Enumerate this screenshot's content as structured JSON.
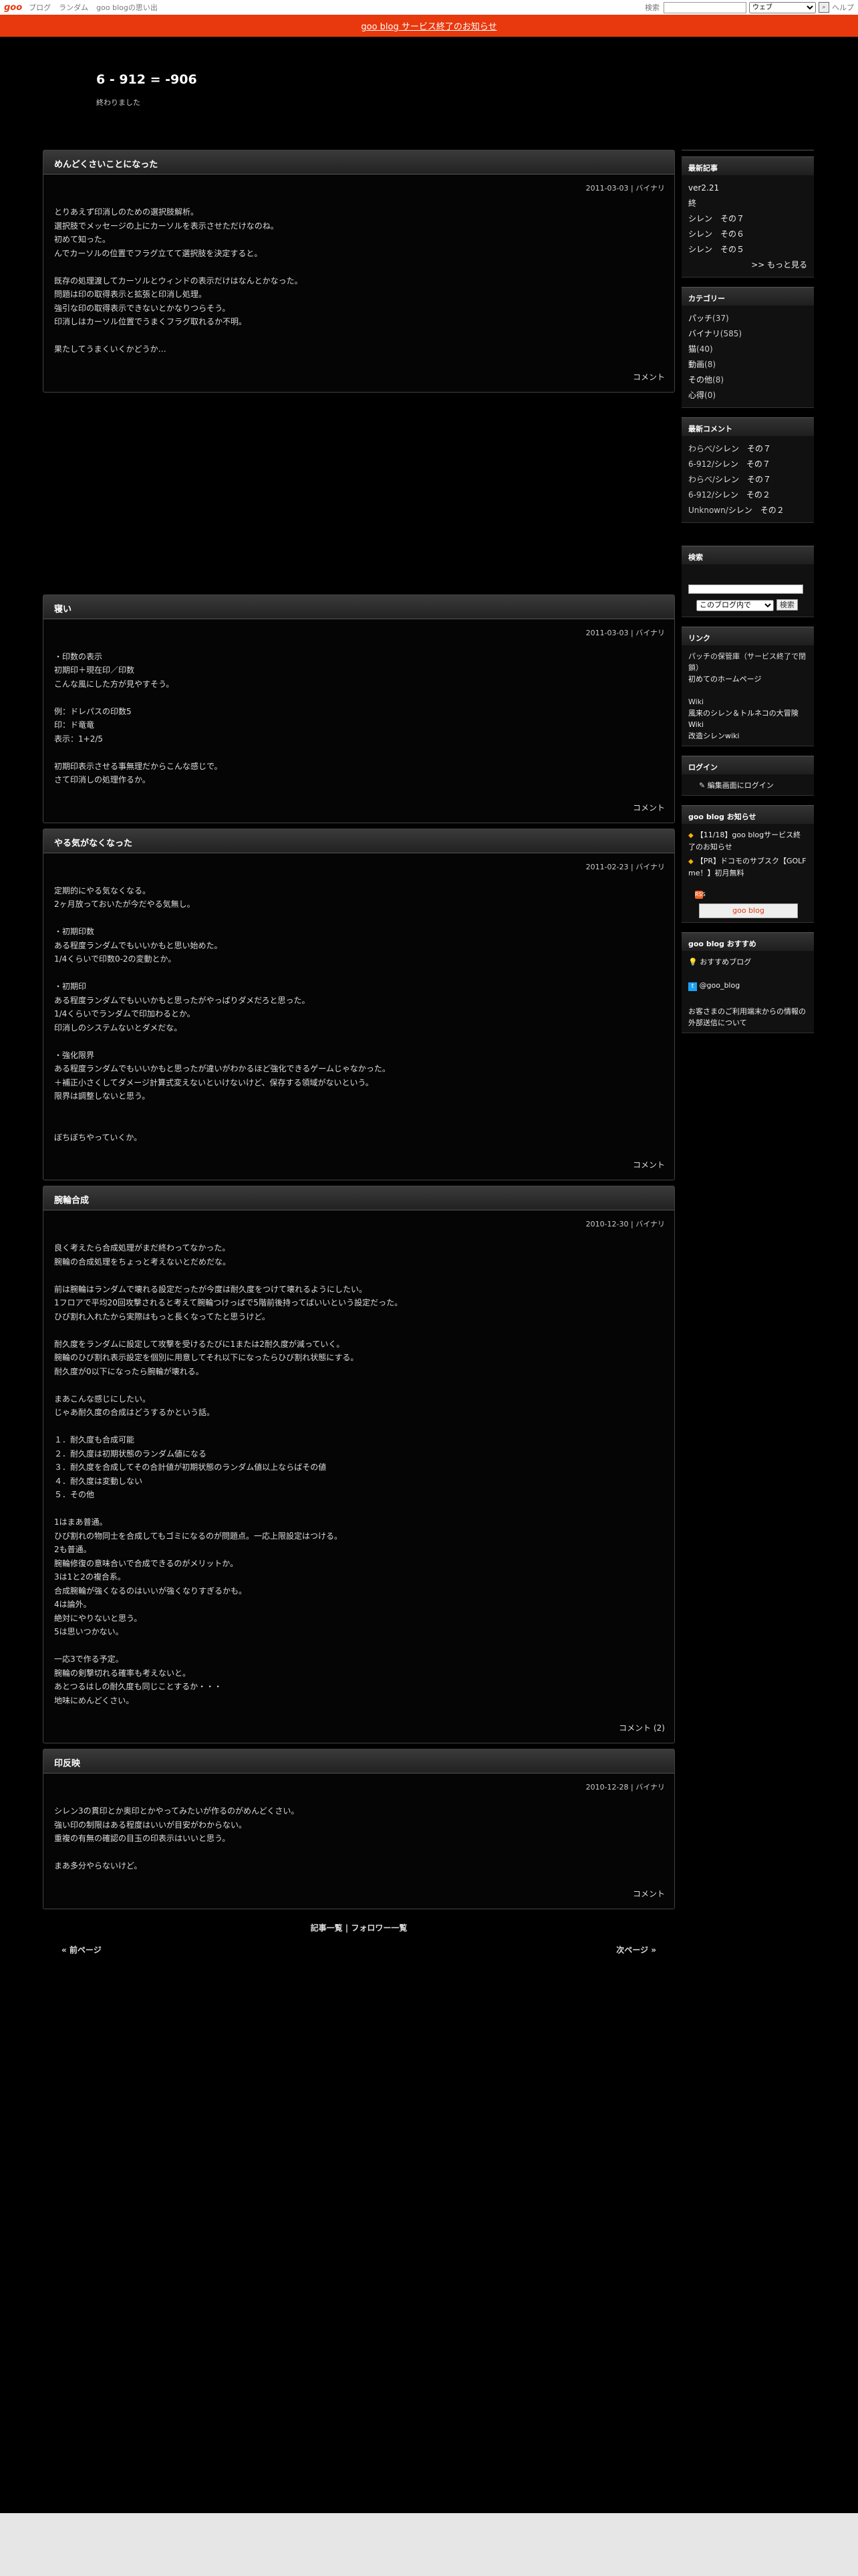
{
  "topbar": {
    "logo": "goo",
    "links": [
      "ブログ",
      "ランダム",
      "goo blogの思い出"
    ],
    "search_label": "検索",
    "search_scope": "ウェブ",
    "help": "ヘルプ"
  },
  "notice": "goo blog サービス終了のお知らせ",
  "site": {
    "title": "6 - 912 = -906",
    "description": "終わりました"
  },
  "entries": [
    {
      "title": "めんどくさいことになった",
      "date": "2011-03-03 | バイナリ",
      "body": [
        "とりあえず印消しのための選択肢解析。",
        "選択肢でメッセージの上にカーソルを表示させただけなのね。",
        "初めて知った。",
        "んでカーソルの位置でフラグ立てて選択肢を決定すると。",
        "",
        "既存の処理渡してカーソルとウィンドの表示だけはなんとかなった。",
        "問題は印の取得表示と拡張と印消し処理。",
        "強引な印の取得表示できないとかなりつらそう。",
        "印消しはカーソル位置でうまくフラグ取れるか不明。",
        "",
        "果たしてうまくいくかどうか…"
      ],
      "foot": "コメント"
    },
    {
      "title": "寝い",
      "date": "2011-03-03 | バイナリ",
      "body": [
        "・印数の表示",
        "初期印＋現在印／印数",
        "こんな風にした方が見やすそう。",
        "",
        "例：ドレパスの印数5",
        "印：ド竜竜",
        "表示：1+2/5",
        "",
        "初期印表示させる事無理だからこんな感じで。",
        "さて印消しの処理作るか。"
      ],
      "foot": "コメント"
    },
    {
      "title": "やる気がなくなった",
      "date": "2011-02-23 | バイナリ",
      "body": [
        "定期的にやる気なくなる。",
        "2ヶ月放っておいたが今だやる気無し。",
        "",
        "・初期印数",
        "ある程度ランダムでもいいかもと思い始めた。",
        "1/4くらいで印数0-2の変動とか。",
        "",
        "・初期印",
        "ある程度ランダムでもいいかもと思ったがやっぱりダメだろと思った。",
        "1/4くらいでランダムで印加わるとか。",
        "印消しのシステムないとダメだな。",
        "",
        "・強化限界",
        "ある程度ランダムでもいいかもと思ったが違いがわかるほど強化できるゲームじゃなかった。",
        "＋補正小さくしてダメージ計算式変えないといけないけど、保存する領域がないという。",
        "限界は調整しないと思う。",
        "",
        "",
        "ぼちぼちやっていくか。"
      ],
      "foot": "コメント"
    },
    {
      "title": "腕輪合成",
      "date": "2010-12-30 | バイナリ",
      "body": [
        "良く考えたら合成処理がまだ終わってなかった。",
        "腕輪の合成処理をちょっと考えないとだめだな。",
        "",
        "前は腕輪はランダムで壊れる設定だったが今度は耐久度をつけて壊れるようにしたい。",
        "1フロアで平均20回攻撃されると考えて腕輪つけっぱで5階前後持ってばいいという設定だった。",
        "ひび割れ入れたから実際はもっと長くなってたと思うけど。",
        "",
        "耐久度をランダムに設定して攻撃を受けるたびに1または2耐久度が減っていく。",
        "腕輪のひび割れ表示設定を個別に用意してそれ以下になったらひび割れ状態にする。",
        "耐久度が0以下になったら腕輪が壊れる。",
        "",
        "まあこんな感じにしたい。",
        "じゃあ耐久度の合成はどうするかという話。",
        "",
        "１．耐久度も合成可能",
        "２．耐久度は初期状態のランダム値になる",
        "３．耐久度を合成してその合計値が初期状態のランダム値以上ならばその値",
        "４．耐久度は変動しない",
        "５．その他",
        "",
        "1はまあ普通。",
        "ひび割れの物同士を合成してもゴミになるのが問題点。一応上限設定はつける。",
        "2も普通。",
        "腕輪修復の意味合いで合成できるのがメリットか。",
        "3は1と2の複合系。",
        "合成腕輪が強くなるのはいいが強くなりすぎるかも。",
        "4は論外。",
        "絶対にやりないと思う。",
        "5は思いつかない。",
        "",
        "一応3で作る予定。",
        "腕輪の剣撃切れる確率も考えないと。",
        "あとつるはしの耐久度も同じことするか・・・",
        "地味にめんどくさい。"
      ],
      "foot": "コメント (2)"
    },
    {
      "title": "印反映",
      "date": "2010-12-28 | バイナリ",
      "body": [
        "シレン3の貫印とか奥印とかやってみたいが作るのがめんどくさい。",
        "強い印の制限はある程度はいいが目安がわからない。",
        "重複の有無の確認の目玉の印表示はいいと思う。",
        "",
        "まあ多分やらないけど。"
      ],
      "foot": "コメント"
    }
  ],
  "list_links": {
    "entries": "記事一覧",
    "sep": "|",
    "followers": "フォロワー一覧"
  },
  "pager": {
    "prev": "« 前ページ",
    "next": "次ページ »"
  },
  "sidebar": {
    "recent": {
      "title": "最新記事",
      "items": [
        "ver2.21",
        "終",
        "シレン　その７",
        "シレン　その６",
        "シレン　その５"
      ],
      "more": ">> もっと見る"
    },
    "categories": {
      "title": "カテゴリー",
      "items": [
        {
          "name": "パッチ",
          "count": "(37)"
        },
        {
          "name": "バイナリ",
          "count": "(585)"
        },
        {
          "name": "猫",
          "count": "(40)"
        },
        {
          "name": "動画",
          "count": "(8)"
        },
        {
          "name": "その他",
          "count": "(8)"
        },
        {
          "name": "心得",
          "count": "(0)"
        }
      ]
    },
    "comments": {
      "title": "最新コメント",
      "items": [
        {
          "who": "わらべ/",
          "what": "シレン　その７"
        },
        {
          "who": "6-912/",
          "what": "シレン　その７"
        },
        {
          "who": "わらべ/",
          "what": "シレン　その７"
        },
        {
          "who": "6-912/",
          "what": "シレン　その２"
        },
        {
          "who": "Unknown/",
          "what": "シレン　その２"
        }
      ]
    },
    "search": {
      "title": "検索",
      "scope": "このブログ内で",
      "button": "検索"
    },
    "links": {
      "title": "リンク",
      "lines": [
        "パッチの保管庫（サービス終了で閉鎖）",
        "初めてのホームページ",
        "",
        "Wiki",
        "風来のシレン＆トルネコの大冒険 Wiki",
        "改造シレンwiki"
      ]
    },
    "login": {
      "title": "ログイン",
      "link": "編集画面にログイン"
    },
    "news": {
      "title": "goo blog お知らせ",
      "items": [
        "【11/18】goo blogサービス終了のお知らせ",
        "【PR】ドコモのサブスク【GOLF me！】初月無料"
      ],
      "button": "goo blog"
    },
    "recommend": {
      "title": "goo blog おすすめ",
      "items": [
        "おすすめブログ",
        "@goo_blog",
        "お客さまのご利用端末からの情報の外部送信について"
      ]
    }
  }
}
